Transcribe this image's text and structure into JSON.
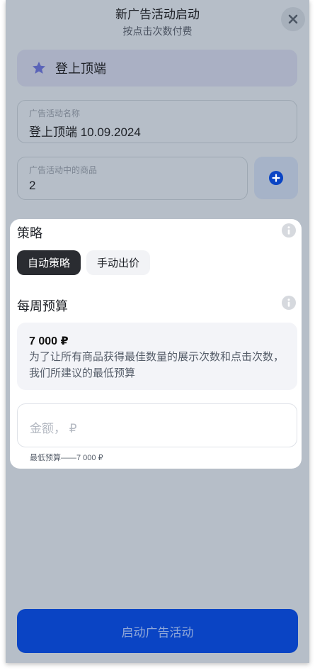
{
  "header": {
    "title": "新广告活动启动",
    "subtitle": "按点击次数付费"
  },
  "promo_card": {
    "icon": "star-icon",
    "label": "登上顶端"
  },
  "campaign_name_field": {
    "label": "广告活动名称",
    "value": "登上顶端 10.09.2024"
  },
  "products_field": {
    "label": "广告活动中的商品",
    "value": "2"
  },
  "strategy": {
    "title": "策略",
    "options": [
      "自动策略",
      "手动出价"
    ],
    "selected": "自动策略"
  },
  "weekly_budget": {
    "title": "每周预算",
    "recommended_amount": "7 000 ₽",
    "recommended_desc": "为了让所有商品获得最佳数量的展示次数和点击次数，我们所建议的最低预算",
    "input_placeholder": "金额， ₽",
    "min_hint": "最低预算——7 000 ₽"
  },
  "launch_button": "启动广告活动",
  "colors": {
    "accent": "#0a44c4",
    "overlay": "#b6bec8",
    "chip_active": "#2a2c31",
    "star": "#5a63b8"
  }
}
